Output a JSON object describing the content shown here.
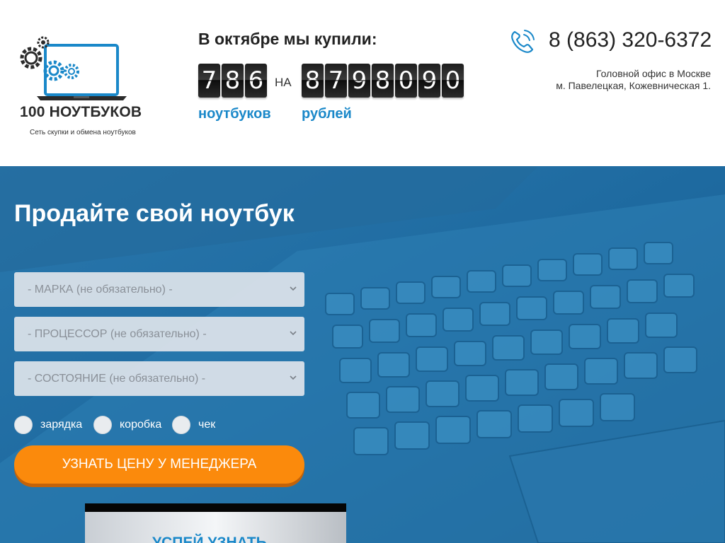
{
  "brand": {
    "name": "100 НОУТБУКОВ",
    "tagline": "Сеть скупки и обмена ноутбуков",
    "logo_icon": "laptop-gears-logo"
  },
  "stats": {
    "title": "В октябре мы купили:",
    "count_digits": [
      "7",
      "8",
      "6"
    ],
    "on_label": "НА",
    "sum_digits": [
      "8",
      "7",
      "9",
      "8",
      "0",
      "9",
      "0"
    ],
    "count_unit": "ноутбуков",
    "sum_unit": "рублей"
  },
  "contact": {
    "phone_icon": "phone-icon",
    "phone": "8 (863) 320-6372",
    "office_line1": "Головной офис в Москве",
    "office_line2": "м. Павелецкая, Кожевническая 1."
  },
  "hero": {
    "title": "Продайте свой ноутбук",
    "selects": [
      {
        "value": "- МАРКА (не обязательно) -"
      },
      {
        "value": "- ПРОЦЕССОР (не обязательно) -"
      },
      {
        "value": "- СОСТОЯНИЕ (не обязательно) -"
      }
    ],
    "checkboxes": [
      {
        "label": "зарядка",
        "checked": false
      },
      {
        "label": "коробка",
        "checked": false
      },
      {
        "label": "чек",
        "checked": false
      }
    ],
    "cta_label": "УЗНАТЬ ЦЕНУ У МЕНЕДЖЕРА",
    "video_text": "УСПЕЙ УЗНАТЬ"
  },
  "colors": {
    "accent_blue": "#1a88c9",
    "cta_orange": "#fb8a0c",
    "hero_blue": "#1f6fa3"
  }
}
